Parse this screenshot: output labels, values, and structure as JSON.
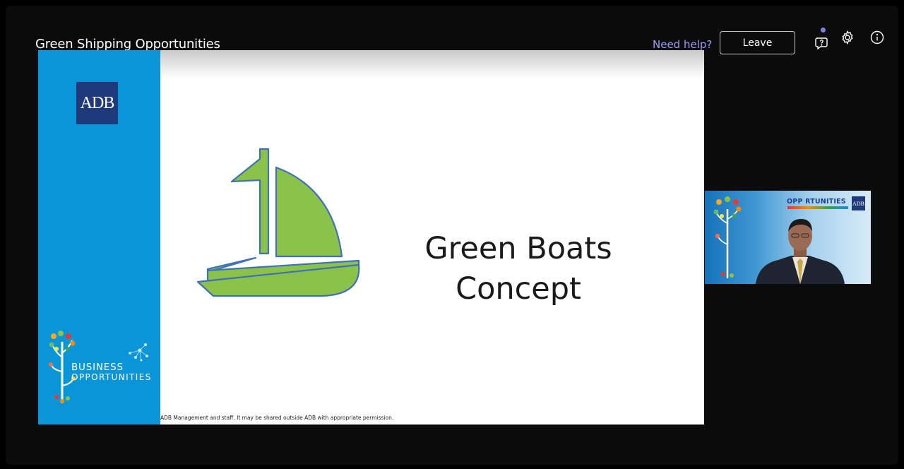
{
  "meeting": {
    "title": "Green Shipping Opportunities",
    "help_link": "Need help?",
    "leave_label": "Leave"
  },
  "toolbar_icons": [
    "help-chat-icon",
    "gear-icon",
    "info-icon"
  ],
  "slide": {
    "logo_text": "ADB",
    "brand_line1": "BUSINESS",
    "brand_line2": "OPPORTUNITIES",
    "title_line1": "Green Boats",
    "title_line2": "Concept",
    "footer": "ADB Management and staff. It may be shared outside ADB with appropriate permission.",
    "colors": {
      "sidebar": "#0b95d9",
      "boat_fill": "#8bc34a",
      "boat_stroke": "#3f72b5"
    }
  },
  "video": {
    "banner": "OPP RTUNITIES",
    "logo_text": "ADB"
  }
}
